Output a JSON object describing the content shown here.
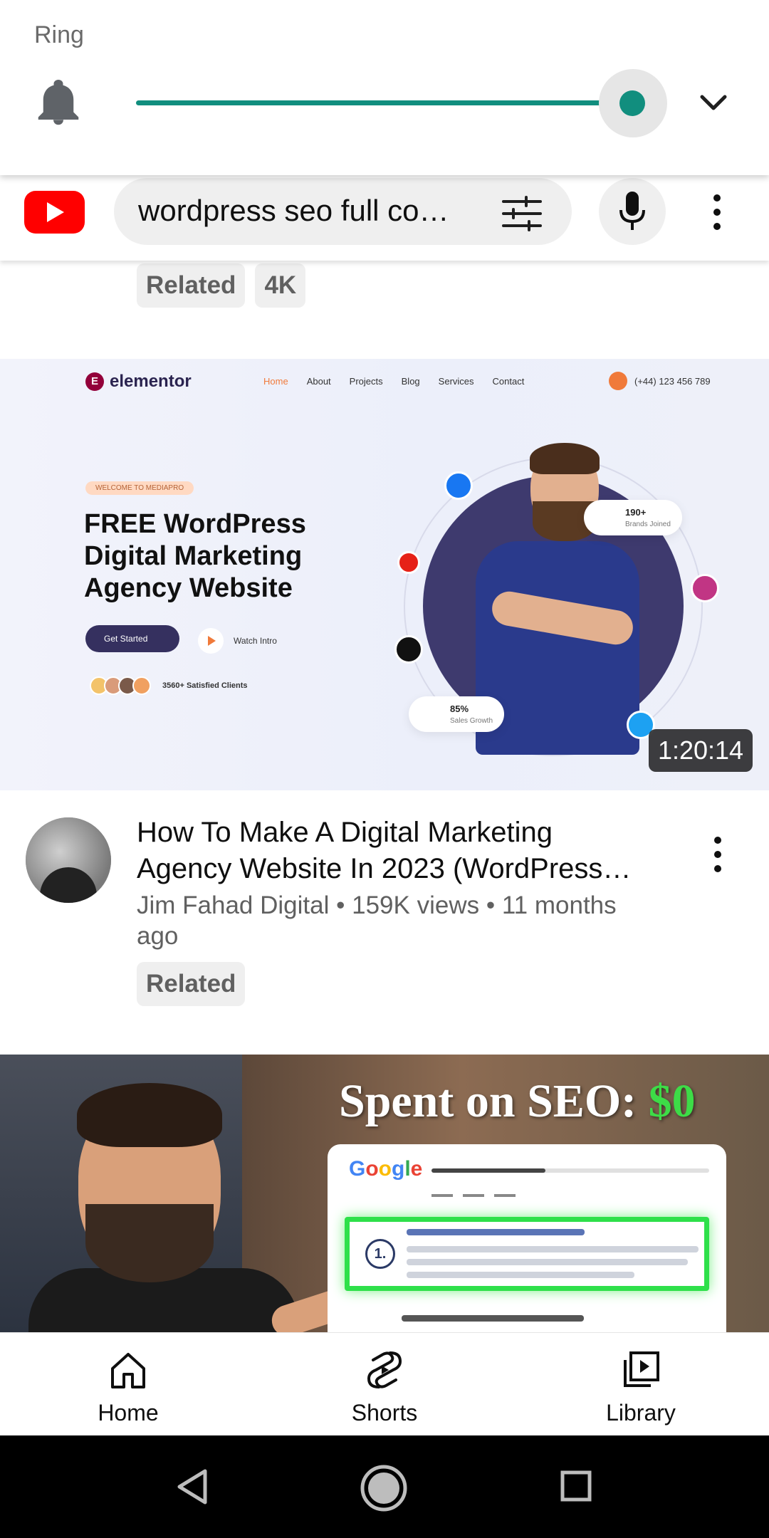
{
  "volume": {
    "label": "Ring",
    "level_percent": 100,
    "accent_color": "#118e7e",
    "icons": [
      "bell-icon",
      "chevron-down-icon"
    ]
  },
  "topbar": {
    "search_query": "wordpress seo full co…",
    "icons": [
      "youtube-logo-icon",
      "filter-icon",
      "mic-icon",
      "more-vert-icon"
    ]
  },
  "chips": {
    "related": "Related",
    "quality": "4K"
  },
  "video1": {
    "thumbnail": {
      "brand": "elementor",
      "nav": [
        "Home",
        "About",
        "Projects",
        "Blog",
        "Services",
        "Contact"
      ],
      "phone": "(+44) 123 456 789",
      "welcome": "WELCOME TO MEDIAPRO",
      "headline": "FREE WordPress Digital Marketing Agency Website",
      "cta_primary": "Get Started",
      "cta_secondary": "Watch Intro",
      "clients": "3560+ Satisfied Clients",
      "stat1_value": "190+",
      "stat1_label": "Brands Joined",
      "stat2_value": "85%",
      "stat2_label": "Sales Growth"
    },
    "duration": "1:20:14",
    "title": "How To Make A Digital Marketing Agency Website In 2023 (WordPress…",
    "channel": "Jim Fahad Digital",
    "views": "159K views",
    "age": "11 months ago",
    "chip": "Related"
  },
  "video2": {
    "thumbnail": {
      "headline_prefix": "Spent on SEO: ",
      "headline_value": "$0",
      "google_logo": "Google",
      "result_rank": "1."
    }
  },
  "bottom_nav": {
    "home": "Home",
    "shorts": "Shorts",
    "library": "Library"
  }
}
